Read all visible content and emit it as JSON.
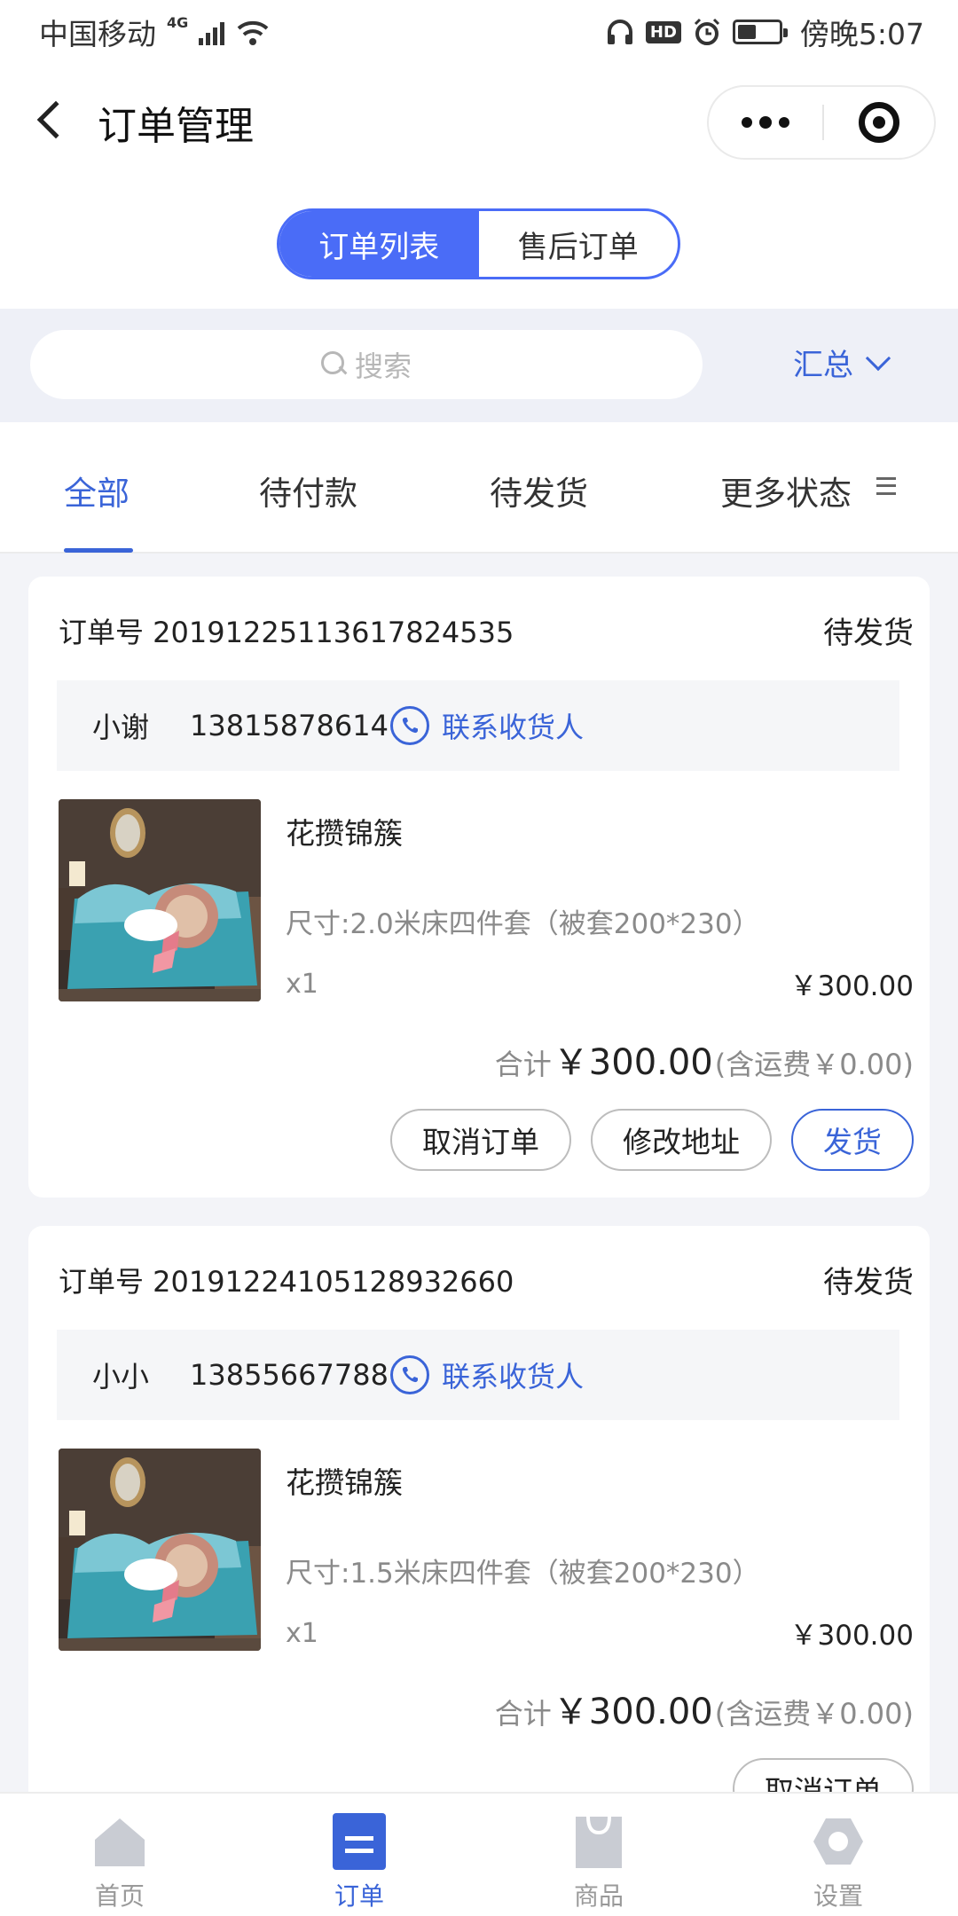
{
  "status_bar": {
    "carrier": "中国移动",
    "network": "4G",
    "hd": "HD",
    "battery_level": 0.45,
    "time": "傍晚5:07"
  },
  "nav": {
    "title": "订单管理"
  },
  "segmented": {
    "tabs": [
      {
        "label": "订单列表",
        "active": true
      },
      {
        "label": "售后订单",
        "active": false
      }
    ]
  },
  "search": {
    "placeholder": "搜索",
    "summary_label": "汇总"
  },
  "status_tabs": {
    "tabs": [
      {
        "label": "全部",
        "active": true
      },
      {
        "label": "待付款"
      },
      {
        "label": "待发货"
      },
      {
        "label": "更多状态"
      }
    ]
  },
  "orders": [
    {
      "order_label": "订单号 20191225113617824535",
      "status": "待发货",
      "contact_name": "小谢",
      "contact_phone": "13815878614",
      "contact_link": "联系收货人",
      "product_name": "花攒锦簇",
      "spec": "尺寸:2.0米床四件套（被套200*230）",
      "qty": "x1",
      "price": "￥300.00",
      "total_prefix": "合计",
      "total": "￥300.00",
      "shipping": "(含运费￥0.00)",
      "buttons": [
        "取消订单",
        "修改地址",
        "发货"
      ]
    },
    {
      "order_label": "订单号 20191224105128932660",
      "status": "待发货",
      "contact_name": "小小",
      "contact_phone": "13855667788",
      "contact_link": "联系收货人",
      "product_name": "花攒锦簇",
      "spec": "尺寸:1.5米床四件套（被套200*230）",
      "qty": "x1",
      "price": "￥300.00",
      "total_prefix": "合计",
      "total": "￥300.00",
      "shipping": "(含运费￥0.00)",
      "buttons": [
        "取消订单"
      ]
    }
  ],
  "tab_bar": {
    "items": [
      {
        "label": "首页",
        "icon": "home-icon"
      },
      {
        "label": "订单",
        "icon": "order-icon",
        "active": true
      },
      {
        "label": "商品",
        "icon": "bag-icon"
      },
      {
        "label": "设置",
        "icon": "gear-icon"
      }
    ]
  },
  "colors": {
    "accent": "#3a64d8",
    "segmented": "#4a6cf7",
    "inactive_tab": "#999999"
  }
}
